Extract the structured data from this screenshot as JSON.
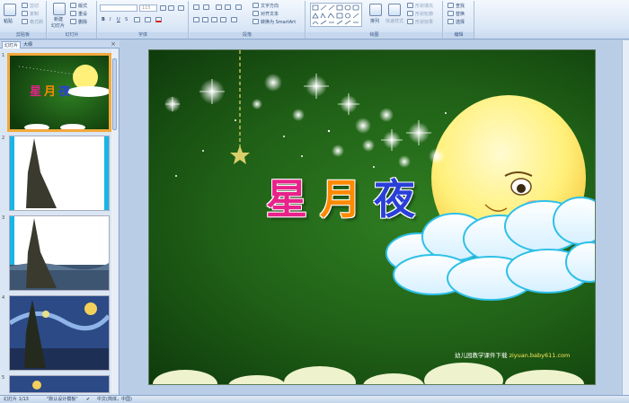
{
  "ribbon": {
    "clipboard": {
      "label": "剪贴板",
      "paste": "粘贴",
      "cut": "剪切",
      "copy": "复制",
      "format_painter": "格式刷"
    },
    "slides": {
      "label": "幻灯片",
      "new_slide": "新建",
      "new_slide2": "幻灯片",
      "layout": "版式",
      "reset": "重设",
      "delete": "删除"
    },
    "font": {
      "label": "字体",
      "font_size": "115"
    },
    "paragraph": {
      "label": "段落",
      "text_direction": "文字方向",
      "align_text": "对齐文本",
      "smartart": "转换为 SmartArt"
    },
    "drawing": {
      "label": "绘图",
      "arrange": "排列",
      "quick_styles": "快速样式",
      "shape_fill": "形状填充",
      "shape_outline": "形状轮廓",
      "shape_effects": "形状效果"
    },
    "editing": {
      "label": "编辑",
      "find": "查找",
      "replace": "替换",
      "select": "选择"
    }
  },
  "panel": {
    "tabs": [
      "幻灯片",
      "大纲"
    ],
    "close": "×",
    "slide_numbers": [
      "1",
      "2",
      "3",
      "4",
      "5"
    ]
  },
  "slide": {
    "title_chars": [
      "星",
      "月",
      "夜"
    ],
    "title_colors": [
      "#e8228a",
      "#ff8a00",
      "#2a3fd8"
    ],
    "credit_prefix": "幼儿园教学课件下载",
    "credit_url": "ziyuan.baby611.com"
  },
  "status": {
    "slide_count": "幻灯片 1/13",
    "theme": "\"默认设计模板\"",
    "language": "中文(简体，中国)"
  }
}
